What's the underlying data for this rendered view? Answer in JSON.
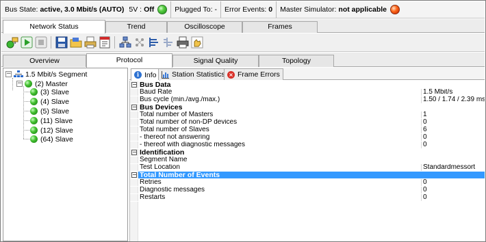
{
  "status_bar": {
    "bus_state_label": "Bus State:",
    "bus_state_value": "active, 3.0 Mbit/s (AUTO)",
    "five_v_label": "5V :",
    "five_v_value": "Off",
    "plugged_to_label": "Plugged To:",
    "plugged_to_value": "-",
    "error_events_label": "Error Events:",
    "error_events_value": "0",
    "master_sim_label": "Master Simulator:",
    "master_sim_value": "not applicable",
    "led_5v_color": "#3cb832",
    "led_master_color": "#e8501a"
  },
  "main_tabs": [
    {
      "label": "Network Status",
      "active": true
    },
    {
      "label": "Trend",
      "active": false
    },
    {
      "label": "Oscilloscope",
      "active": false
    },
    {
      "label": "Frames",
      "active": false
    }
  ],
  "toolbar_icons": [
    "go-online-icon",
    "play-icon",
    "stop-icon",
    "save-icon",
    "open-folder-icon",
    "print-setup-icon",
    "report-icon",
    "network-config-icon",
    "scan-icon",
    "export-icon",
    "import-icon",
    "print-icon",
    "settings-hand-icon"
  ],
  "sub_tabs": [
    {
      "label": "Overview",
      "active": false
    },
    {
      "label": "Protocol",
      "active": true
    },
    {
      "label": "Signal Quality",
      "active": false
    },
    {
      "label": "Topology",
      "active": false
    }
  ],
  "tree": {
    "root": "1.5 Mbit/s Segment",
    "master": "(2) Master",
    "slaves": [
      "(3) Slave",
      "(4) Slave",
      "(5) Slave",
      "(11) Slave",
      "(12) Slave",
      "(64) Slave"
    ]
  },
  "detail_tabs": [
    {
      "label": "Info",
      "active": true,
      "icon": "info-icon"
    },
    {
      "label": "Station Statistics",
      "active": false,
      "icon": "statistics-icon"
    },
    {
      "label": "Frame Errors",
      "active": false,
      "icon": "error-icon"
    }
  ],
  "properties": {
    "bus_data": {
      "title": "Bus Data",
      "baud_rate_label": "Baud Rate",
      "baud_rate_value": "1.5 Mbit/s",
      "bus_cycle_label": "Bus cycle (min./avg./max.)",
      "bus_cycle_value": "1.50 / 1.74 / 2.39 ms"
    },
    "bus_devices": {
      "title": "Bus Devices",
      "masters_label": "Total number of Masters",
      "masters_value": "1",
      "non_dp_label": "Total number of non-DP devices",
      "non_dp_value": "0",
      "slaves_label": "Total number of Slaves",
      "slaves_value": "6",
      "not_answering_label": "- thereof not answering",
      "not_answering_value": "0",
      "diag_label": "- thereof with diagnostic messages",
      "diag_value": "0"
    },
    "identification": {
      "title": "Identification",
      "segment_name_label": "Segment Name",
      "segment_name_value": "",
      "test_location_label": "Test Location",
      "test_location_value": "Standardmessort"
    },
    "events": {
      "title": "Total Number of Events",
      "retries_label": "Retries",
      "retries_value": "0",
      "diag_messages_label": "Diagnostic messages",
      "diag_messages_value": "0",
      "restarts_label": "Restarts",
      "restarts_value": "0"
    }
  },
  "colors": {
    "selection": "#3399ff",
    "accent_blue": "#2e72d2"
  }
}
